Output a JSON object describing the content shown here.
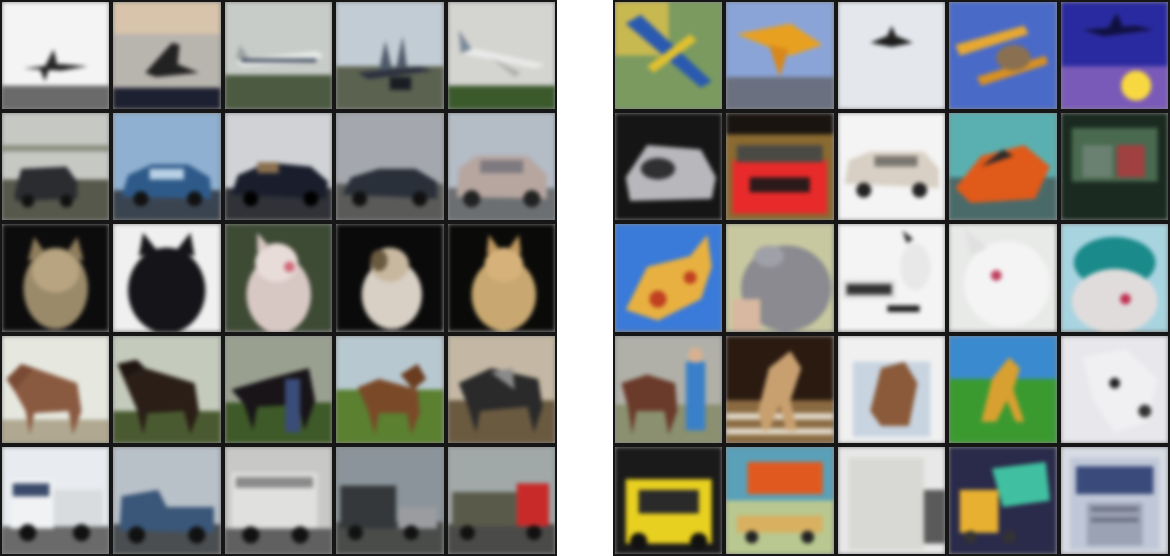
{
  "left_grid": {
    "rows": [
      {
        "class": "airplane",
        "tiles": [
          "airplane-on-white-sky",
          "jet-silhouette-dusk",
          "airliner-runway",
          "fighter-jet-runway",
          "airliner-grey-sky"
        ]
      },
      {
        "class": "automobile",
        "tiles": [
          "dark-hatchback",
          "blue-sedan",
          "black-convertible",
          "dark-sedan",
          "silver-suv"
        ]
      },
      {
        "class": "cat",
        "tiles": [
          "tabby-cat-dark",
          "black-cat-white-bg",
          "white-cat-green-bg",
          "calico-cat-dark",
          "ginger-cat-dark"
        ]
      },
      {
        "class": "horse",
        "tiles": [
          "brown-horse-white-bg",
          "dark-horse-field",
          "horse-with-rider",
          "horse-green-field",
          "dark-horse-pasture"
        ]
      },
      {
        "class": "truck",
        "tiles": [
          "white-semi-truck",
          "blue-pickup-truck",
          "white-box-truck",
          "grey-truck-road",
          "red-cab-dump-truck"
        ]
      }
    ]
  },
  "right_grid": {
    "rows": [
      {
        "class": "airplane",
        "tiles": [
          "blue-toy-plane",
          "yellow-plane-blue-sky",
          "black-jet-white-sky",
          "yellow-biplane",
          "plane-over-sunset"
        ]
      },
      {
        "class": "automobile",
        "tiles": [
          "silver-car-dark",
          "red-car-front",
          "white-station-wagon",
          "orange-race-car",
          "green-car-interior"
        ]
      },
      {
        "class": "cat",
        "tiles": [
          "orange-cartoon-cat",
          "grey-cat-closeup",
          "cat-with-sign",
          "white-cat-face",
          "cat-teal-hat"
        ]
      },
      {
        "class": "horse",
        "tiles": [
          "horse-and-person",
          "rearing-horse",
          "horse-head-sketch",
          "orange-horse-grass",
          "white-horse-head"
        ]
      },
      {
        "class": "truck",
        "tiles": [
          "yellow-cab-vehicle",
          "orange-toy-truck",
          "white-cargo-truck",
          "teal-dump-truck",
          "blue-truck-front"
        ]
      }
    ]
  },
  "colors": {
    "grid_border": "#161616",
    "background": "#ffffff"
  }
}
